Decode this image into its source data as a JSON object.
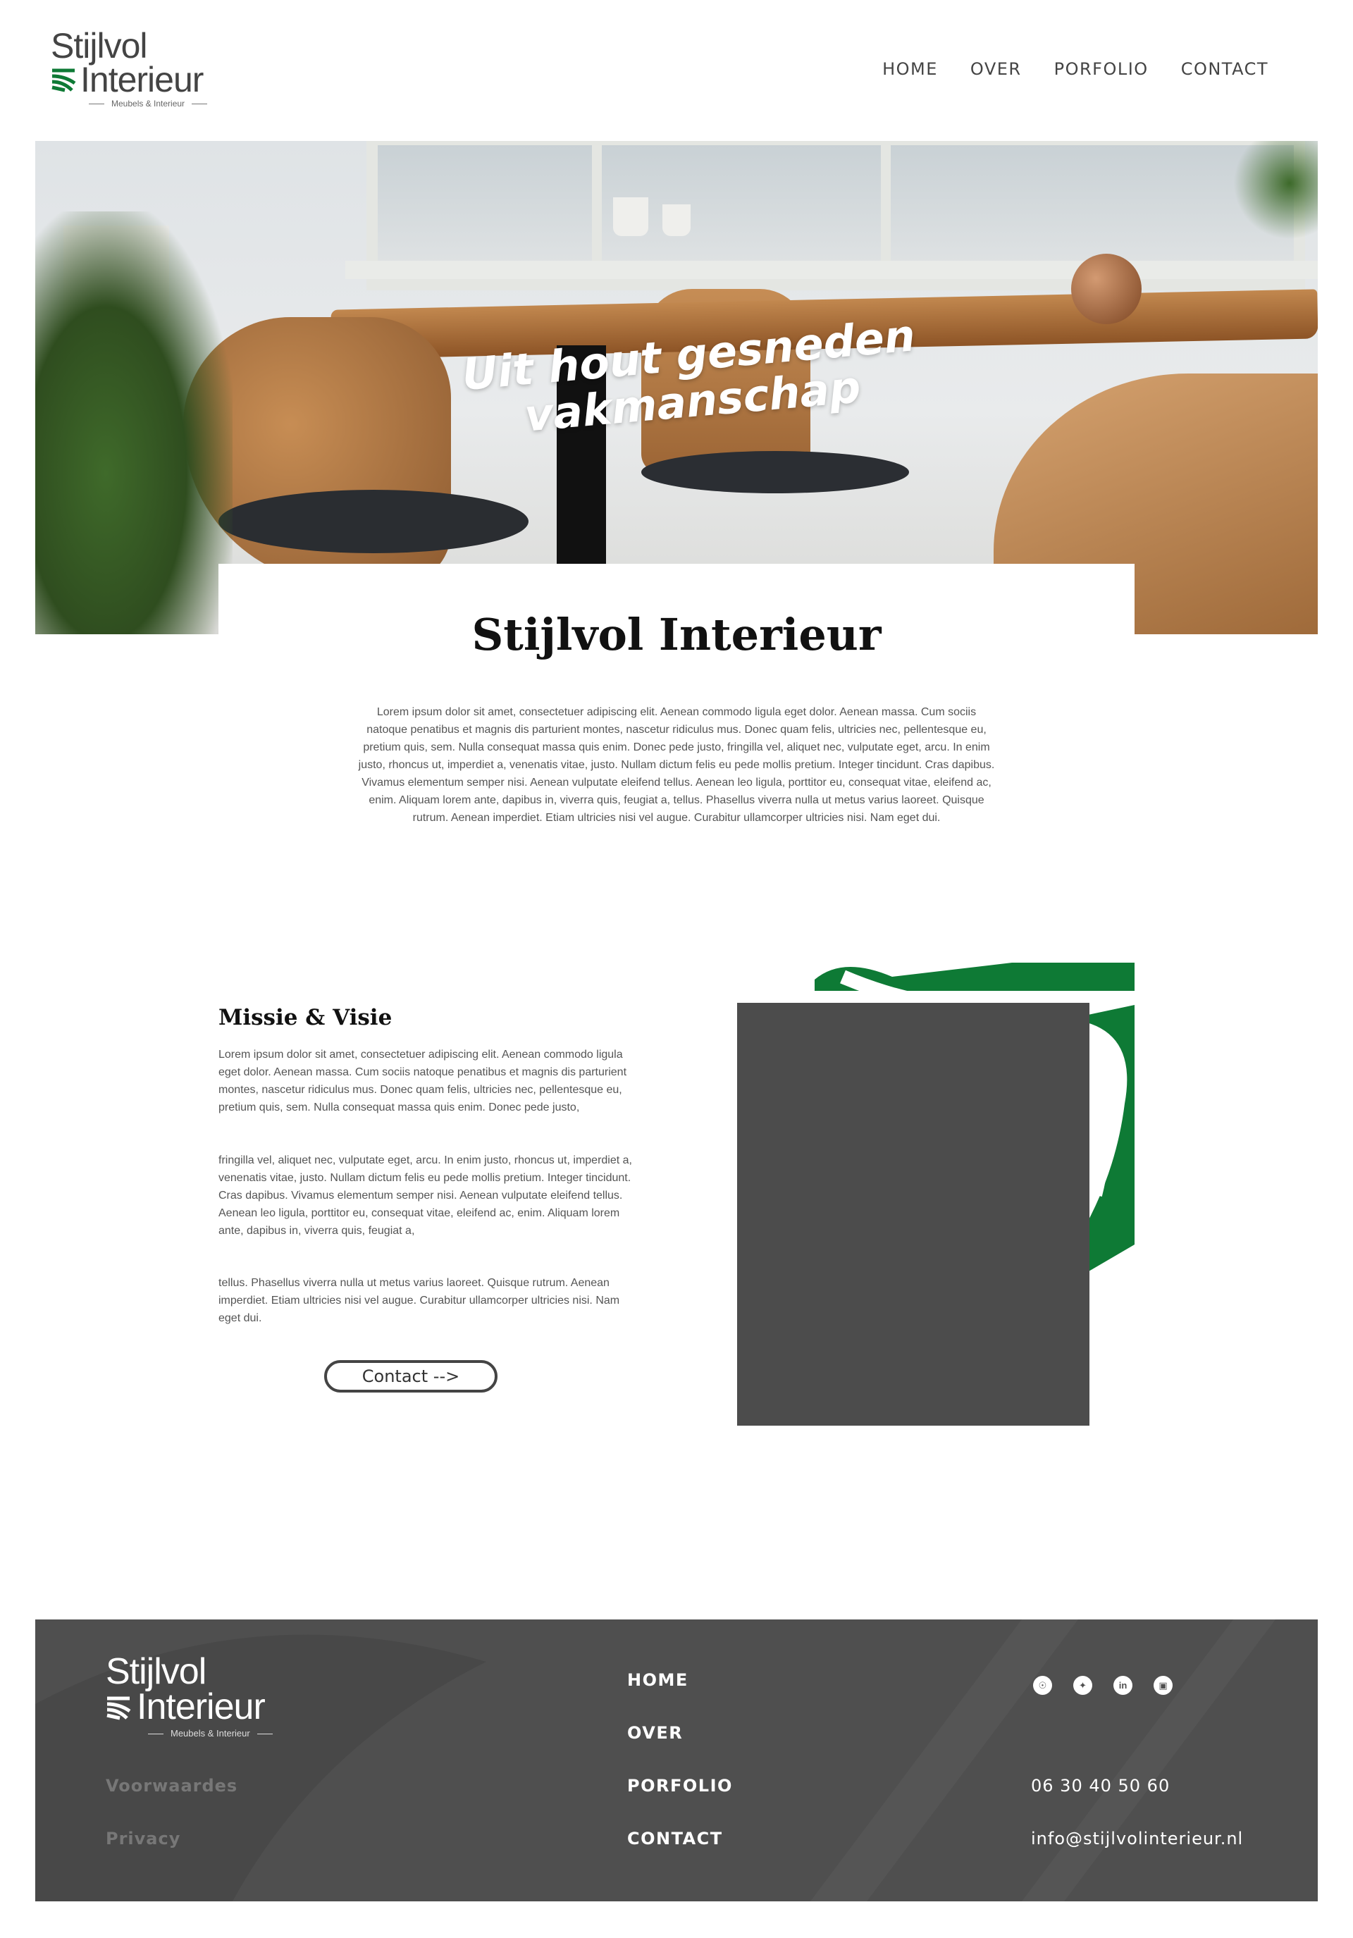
{
  "header": {
    "logo": {
      "line1": "Stijlvol",
      "line2": "Interieur",
      "tagline": "Meubels & Interieur"
    },
    "nav": [
      "HOME",
      "OVER",
      "PORFOLIO",
      "CONTACT"
    ]
  },
  "hero": {
    "title_line1": "Uit hout gesneden",
    "title_line2": "vakmanschap"
  },
  "intro": {
    "title": "Stijlvol Interieur",
    "text": "Lorem ipsum dolor sit amet, consectetuer adipiscing elit. Aenean commodo ligula eget dolor. Aenean massa. Cum sociis natoque penatibus et magnis dis parturient montes, nascetur ridiculus mus. Donec quam felis, ultricies nec, pellentesque eu, pretium quis, sem. Nulla consequat massa quis enim. Donec pede justo, fringilla vel, aliquet nec, vulputate eget, arcu. In enim justo, rhoncus ut, imperdiet a, venenatis vitae, justo. Nullam dictum felis eu pede mollis pretium. Integer tincidunt. Cras dapibus. Vivamus elementum semper nisi. Aenean vulputate eleifend tellus. Aenean leo ligula, porttitor eu, consequat vitae, eleifend ac, enim. Aliquam lorem ante, dapibus in, viverra quis, feugiat a, tellus. Phasellus viverra nulla ut metus varius laoreet. Quisque rutrum. Aenean imperdiet. Etiam ultricies nisi vel augue. Curabitur ullamcorper ultricies nisi. Nam eget dui."
  },
  "mission": {
    "title": "Missie & Visie",
    "p1": "Lorem ipsum dolor sit amet, consectetuer adipiscing elit. Aenean commodo ligula eget dolor. Aenean massa. Cum sociis natoque penatibus et magnis dis parturient montes, nascetur ridiculus mus. Donec quam felis, ultricies nec, pellentesque eu, pretium quis, sem. Nulla consequat massa quis enim. Donec pede justo,",
    "p2": "fringilla vel, aliquet nec, vulputate eget, arcu. In enim justo, rhoncus ut, imperdiet a, venenatis vitae, justo. Nullam dictum felis eu pede mollis pretium. Integer tincidunt. Cras dapibus. Vivamus elementum semper nisi. Aenean vulputate eleifend tellus. Aenean leo ligula, porttitor eu, consequat vitae, eleifend ac, enim. Aliquam lorem ante, dapibus in, viverra quis, feugiat a,",
    "p3": "tellus. Phasellus viverra nulla ut metus varius laoreet. Quisque rutrum. Aenean imperdiet. Etiam ultricies nisi vel augue. Curabitur ullamcorper ultricies nisi. Nam eget dui.",
    "button": "Contact  -->"
  },
  "footer": {
    "logo": {
      "line1": "Stijlvol",
      "line2": "Interieur",
      "tagline": "Meubels & Interieur"
    },
    "legal": [
      "Voorwaardes",
      "Privacy"
    ],
    "nav": [
      "HOME",
      "OVER",
      "PORFOLIO",
      "CONTACT"
    ],
    "social_icons": [
      "snapchat-icon",
      "twitter-icon",
      "linkedin-icon",
      "instagram-icon"
    ],
    "phone": "06 30 40 50 60",
    "email": "info@stijlvolinterieur.nl"
  },
  "colors": {
    "brand_green": "#0e7a35",
    "dark_grey": "#4c4c4c",
    "footer_bg": "#4f4f4f"
  }
}
